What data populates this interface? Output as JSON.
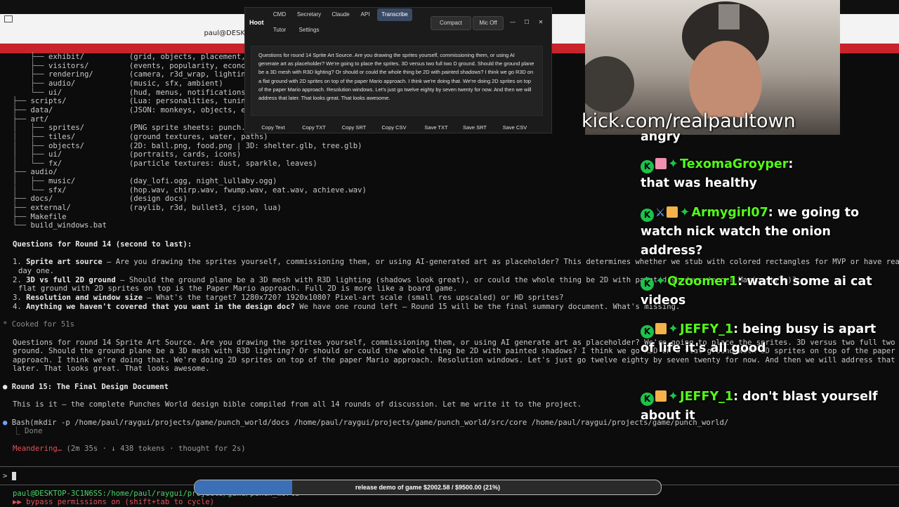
{
  "terminal": {
    "title": "paul@DESKTOP-3C1N6SS: ~/raygui/projects/game/punch_world",
    "tree": [
      {
        "name": "exhibit/",
        "desc": "(grid, objects, placement, unloc"
      },
      {
        "name": "visitors/",
        "desc": "(events, popularity, economy)"
      },
      {
        "name": "rendering/",
        "desc": "(camera, r3d_wrap, lighting, spr"
      },
      {
        "name": "audio/",
        "desc": "(music, sfx, ambient)"
      },
      {
        "name": "ui/",
        "desc": "(hud, menus, notifications, cata"
      },
      {
        "name": "scripts/",
        "desc": "(Lua: personalities, tuning, eve"
      },
      {
        "name": "data/",
        "desc": "(JSON: monkeys, objects, exhibit"
      },
      {
        "name": "art/",
        "desc": ""
      },
      {
        "name": "sprites/",
        "desc": "(PNG sprite sheets: punch.png, m"
      },
      {
        "name": "tiles/",
        "desc": "(ground textures, water, paths)"
      },
      {
        "name": "objects/",
        "desc": "(2D: ball.png, food.png | 3D: shelter.glb, tree.glb)"
      },
      {
        "name": "ui/",
        "desc": "(portraits, cards, icons)"
      },
      {
        "name": "fx/",
        "desc": "(particle textures: dust, sparkle, leaves)"
      },
      {
        "name": "audio/",
        "desc": ""
      },
      {
        "name": "music/",
        "desc": "(day_lofi.ogg, night_lullaby.ogg)"
      },
      {
        "name": "sfx/",
        "desc": "(hop.wav, chirp.wav, fwump.wav, eat.wav, achieve.wav)"
      },
      {
        "name": "docs/",
        "desc": "(design docs)"
      },
      {
        "name": "external/",
        "desc": "(raylib, r3d, bullet3, cjson, lua)"
      },
      {
        "name": "Makefile",
        "desc": ""
      },
      {
        "name": "build_windows.bat",
        "desc": ""
      }
    ],
    "questions_heading": "Questions for Round 14 (second to last):",
    "q1_title": "Sprite art source",
    "q1_text": " — Are you drawing the sprites yourself, commissioning them, or using AI-generated art as placeholder? This determines whether we stub with colored rectangles for MVP or have real",
    "q1_cont": "day one.",
    "q2_title": "3D vs full 2D ground",
    "q2_text": " — Should the ground plane be a 3D mesh with R3D lighting (shadows look great), or could the whole thing be 2D with painted shadows (paper Mario style)?",
    "q2_cont": "flat ground with 2D sprites on top is the Paper Mario approach. Full 2D is more like a board game.",
    "q3_title": "Resolution and window size",
    "q3_text": " — What's the target? 1280x720? 1920x1080? Pixel-art scale (small res upscaled) or HD sprites?",
    "q4_title": "Anything we haven't covered that you want in the design doc?",
    "q4_text": " We have one round left — Round 15 will be the final summary document. What's missing.",
    "cooked": "Cooked for 51s",
    "user_msg_1": "Questions for round 14 Sprite Art Source. Are you drawing the sprites yourself, commissioning them, or using AI generate art as placeholder? We're going to place the sprites. 3D versus two full two D",
    "user_msg_2": "ground. Should the ground plane be a 3D mesh with R3D lighting? Or should or could the whole thing be 2D with painted shadows? I think we go R3D on a flat ground with 2D sprites on top of the paper M",
    "user_msg_3": "approach. I think we're doing that. We're doing 2D sprites on top of the paper Mario approach. Resolution windows. Let's just go twelve eighty by seven twenty for now. And then we will address that",
    "user_msg_4": "later. That looks great. That looks awesome.",
    "round15": "Round 15: The Final Design Document",
    "round15_text": "This is it — the complete Punches World design bible compiled from all 14 rounds of discussion. Let me write it to the project.",
    "bash_cmd": "Bash(mkdir -p /home/paul/raygui/projects/game/punch_world/docs /home/paul/raygui/projects/game/punch_world/src/core /home/paul/raygui/projects/game/punch_world/",
    "bash_done": "Done",
    "meandering": "Meandering…",
    "meandering_stats": " (2m 35s · ↓ 438 tokens · thought for 2s)",
    "prompt_symbol": ">",
    "status_path": "paul@DESKTOP-3C1N6SS:/home/paul/raygui/projects/game/punch_world",
    "bypass": "▶▶ bypass permissions on (shift+tab to cycle)"
  },
  "hoot": {
    "title": "Hoot",
    "tabs_row1": [
      "CMD",
      "Secretary",
      "Claude",
      "API",
      "Transcribe"
    ],
    "tabs_row2": [
      "Tutor",
      "Settings"
    ],
    "active_tab": "Transcribe",
    "compact_label": "Compact",
    "mic_label": "Mic Off",
    "transcript": "Questions for round 14 Sprite Art Source. Are you drawing the sprites yourself, commissioning them, or using AI generate art as placeholder? We're going to place the sprites. 3D versus two full two D ground. Should the ground plane be a 3D mesh with R3D lighting? Or should or could the whole thing be 2D with painted shadows? I think we go R3D on a flat ground with 2D sprites on top of the paper Mario approach. I think we're doing that. We're doing 2D sprites on top of the paper Mario approach. Resolution windows. Let's just go twelve eighty by seven twenty for now. And then we will address that later. That looks great. That looks awesome.",
    "copy_buttons": [
      "Copy Text",
      "Copy TXT",
      "Copy SRT",
      "Copy CSV",
      "Save TXT",
      "Save SRT",
      "Save CSV"
    ],
    "win_minimize": "—",
    "win_maximize": "☐",
    "win_close": "✕"
  },
  "stream": {
    "kick_url": "kick.com/realpaultown",
    "chat": [
      {
        "user": "",
        "message": "angry"
      },
      {
        "user": "TexomaGroyper",
        "message": "that was healthy"
      },
      {
        "user": "Armygirl07",
        "message": "we going to watch nick watch the onion address?"
      },
      {
        "user": "Qzoomer1",
        "message": "watch some ai cat videos"
      },
      {
        "user": "JEFFY_1",
        "message": "being busy is apart of life it's all good"
      },
      {
        "user": "JEFFY_1",
        "message": "don't blast yourself about it"
      }
    ],
    "goal_text": "release demo of game $2002.58 / $9500.00 (21%)",
    "goal_progress": 0.21
  }
}
